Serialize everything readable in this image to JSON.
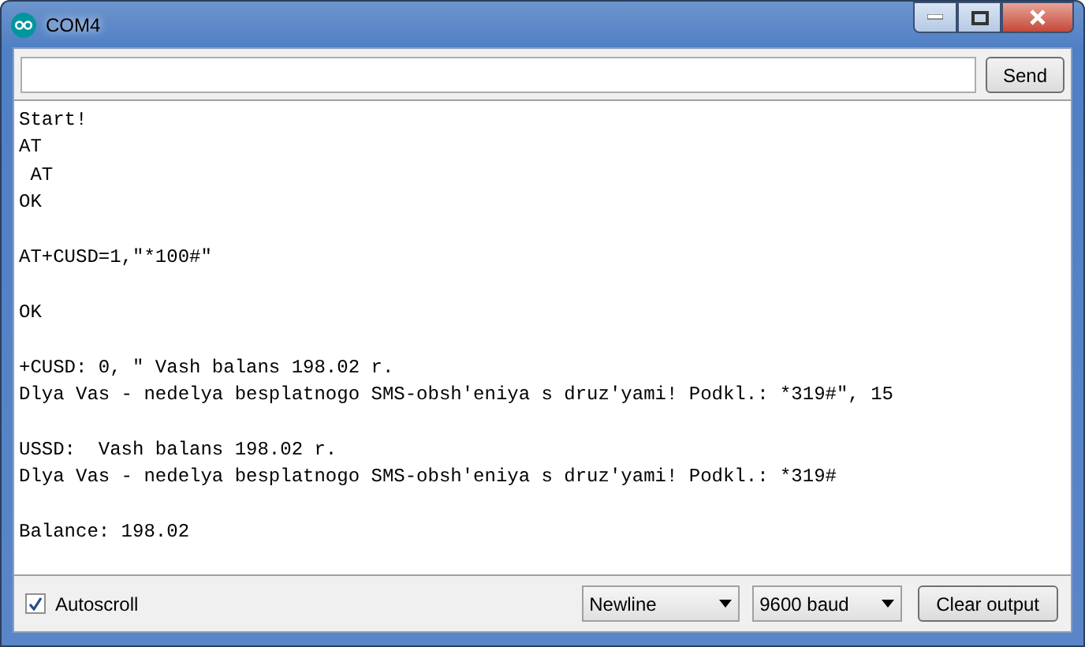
{
  "window": {
    "title": "COM4"
  },
  "send_button": "Send",
  "output_blocks": [
    [
      "Start!",
      "AT",
      " AT",
      "OK"
    ],
    [
      "AT+CUSD=1,\"*100#\""
    ],
    [
      "OK"
    ],
    [
      "+CUSD: 0, \" Vash balans 198.02 r.",
      "Dlya Vas - nedelya besplatnogo SMS-obsh'eniya s druz'yami! Podkl.: *319#\", 15"
    ],
    [
      "USSD:  Vash balans 198.02 r.",
      "Dlya Vas - nedelya besplatnogo SMS-obsh'eniya s druz'yami! Podkl.: *319#"
    ],
    [
      "Balance: 198.02"
    ]
  ],
  "autoscroll": {
    "label": "Autoscroll",
    "checked": true
  },
  "line_ending": "Newline",
  "baud": "9600 baud",
  "clear_button": "Clear output"
}
